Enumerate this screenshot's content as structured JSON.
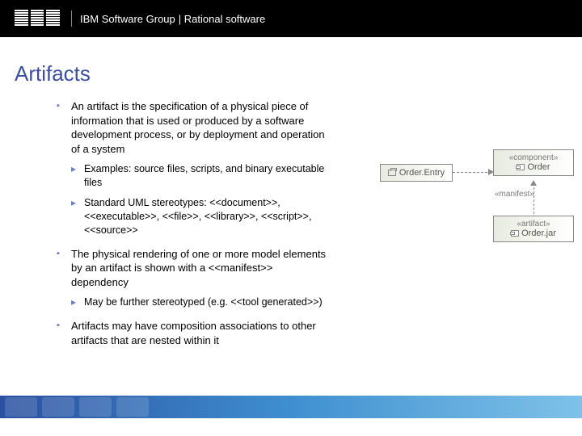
{
  "banner": {
    "logo_alt": "IBM",
    "part1": "IBM Software Group",
    "part2": "| Rational software"
  },
  "title": "Artifacts",
  "bullets": {
    "b1": "An artifact is the specification of a physical piece of information that is used or produced by a software development process, or by deployment and operation of a system",
    "b1_sub1": "Examples: source files, scripts, and binary executable files",
    "b1_sub2": "Standard UML stereotypes: <<document>>, <<executable>>, <<file>>, <<library>>, <<script>>, <<source>>",
    "b2": "The physical rendering of one or more model elements by an artifact is shown with a <<manifest>> dependency",
    "b2_sub1": "May be further stereotyped (e.g. <<tool generated>>)",
    "b3": "Artifacts may have composition associations to other artifacts that are nested within it"
  },
  "diagram": {
    "order_entry": "Order.Entry",
    "component_stereo": "«component»",
    "order": "Order",
    "manifest": "«manifest»",
    "artifact_stereo": "«artifact»",
    "order_jar": "Order.jar"
  }
}
